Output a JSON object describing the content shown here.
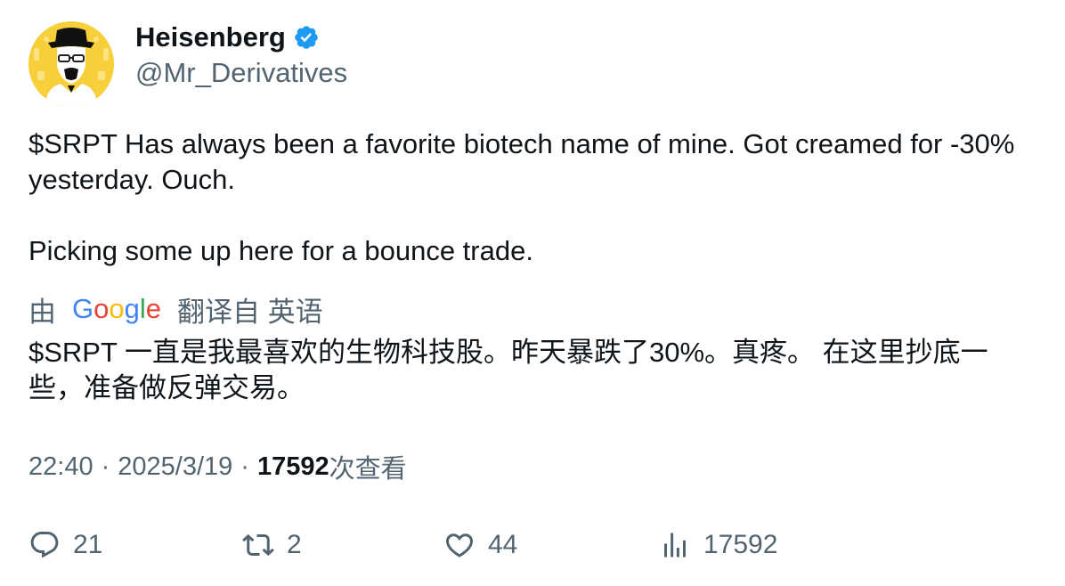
{
  "user": {
    "display_name": "Heisenberg",
    "handle": "@Mr_Derivatives",
    "verified": true,
    "avatar_icon": "heisenberg-avatar",
    "avatar_bg": "#f7cf3a"
  },
  "tweet": {
    "text": "$SRPT Has always been a favorite biotech name of mine. Got creamed for -30% yesterday. Ouch.\n\nPicking some up here for a bounce trade."
  },
  "translation": {
    "by": "由",
    "provider": "Google",
    "source": "翻译自 英语",
    "text": "$SRPT 一直是我最喜欢的生物科技股。昨天暴跌了30%。真疼。 在这里抄底一些，准备做反弹交易。"
  },
  "meta": {
    "time": "22:40",
    "separator": "·",
    "date": "2025/3/19",
    "views_count": "17592",
    "views_label": "次查看"
  },
  "actions": {
    "replies": "21",
    "retweets": "2",
    "likes": "44",
    "views": "17592"
  },
  "colors": {
    "text": "#0f1419",
    "secondary": "#536471",
    "verified_blue": "#1d9bf0"
  }
}
